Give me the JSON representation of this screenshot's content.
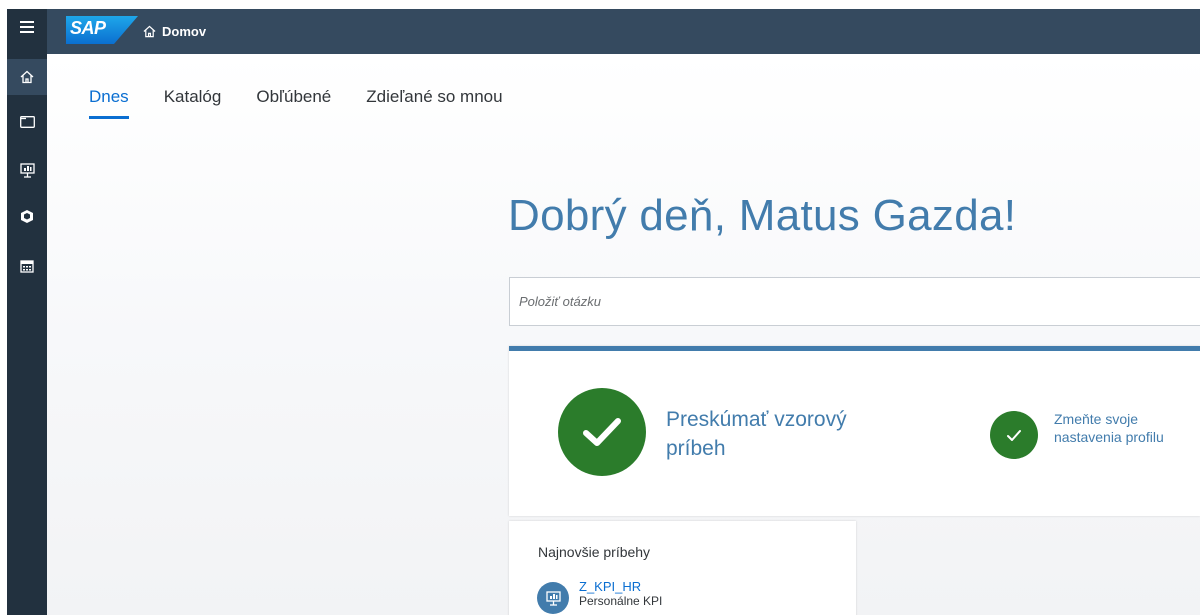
{
  "shell": {
    "logo_text": "SAP",
    "home_label": "Domov",
    "colors": {
      "header": "#354a5f",
      "rail": "#22313f",
      "accent": "#427cac",
      "success": "#2b7c2b",
      "link": "#0a6ed1"
    }
  },
  "rail": {
    "items": [
      {
        "icon": "menu-icon",
        "label": ""
      },
      {
        "icon": "home-icon",
        "label": ""
      },
      {
        "icon": "folder-icon",
        "label": ""
      },
      {
        "icon": "presentation-icon",
        "label": ""
      },
      {
        "icon": "cube-icon",
        "label": ""
      },
      {
        "icon": "calendar-icon",
        "label": ""
      }
    ]
  },
  "tabs": [
    {
      "label": "Dnes",
      "active": true
    },
    {
      "label": "Katalóg",
      "active": false
    },
    {
      "label": "Obľúbené",
      "active": false
    },
    {
      "label": "Zdieľané so mnou",
      "active": false
    }
  ],
  "greeting": "Dobrý deň, Matus Gazda!",
  "search": {
    "placeholder": "Položiť otázku",
    "value": ""
  },
  "feature": {
    "primary_label": "Preskúmať vzorový príbeh",
    "secondary_label": "Zmeňte svoje nastavenia profilu"
  },
  "recent": {
    "title": "Najnovšie príbehy",
    "items": [
      {
        "name": "Z_KPI_HR",
        "description": "Personálne KPI",
        "icon": "story-icon"
      }
    ]
  }
}
